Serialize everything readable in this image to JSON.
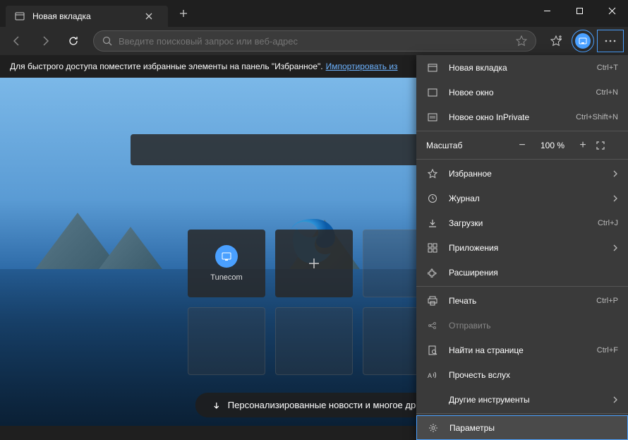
{
  "tab": {
    "title": "Новая вкладка"
  },
  "addressbar": {
    "placeholder": "Введите поисковый запрос или веб-адрес"
  },
  "import_bar": {
    "text": "Для быстрого доступа поместите избранные элементы на панель \"Избранное\".",
    "link": "Импортировать из"
  },
  "tiles": {
    "items": [
      {
        "label": "Tunecom",
        "icon_color": "#4aa0ff"
      }
    ]
  },
  "news_button": {
    "label": "Персонализированные новости и многое др"
  },
  "menu": {
    "new_tab": {
      "label": "Новая вкладка",
      "shortcut": "Ctrl+T"
    },
    "new_window": {
      "label": "Новое окно",
      "shortcut": "Ctrl+N"
    },
    "new_inprivate": {
      "label": "Новое окно InPrivate",
      "shortcut": "Ctrl+Shift+N"
    },
    "zoom": {
      "label": "Масштаб",
      "value": "100 %"
    },
    "favorites": {
      "label": "Избранное"
    },
    "history": {
      "label": "Журнал"
    },
    "downloads": {
      "label": "Загрузки",
      "shortcut": "Ctrl+J"
    },
    "apps": {
      "label": "Приложения"
    },
    "extensions": {
      "label": "Расширения"
    },
    "print": {
      "label": "Печать",
      "shortcut": "Ctrl+P"
    },
    "share": {
      "label": "Отправить"
    },
    "find": {
      "label": "Найти на странице",
      "shortcut": "Ctrl+F"
    },
    "read_aloud": {
      "label": "Прочесть вслух"
    },
    "more_tools": {
      "label": "Другие инструменты"
    },
    "settings": {
      "label": "Параметры"
    }
  }
}
